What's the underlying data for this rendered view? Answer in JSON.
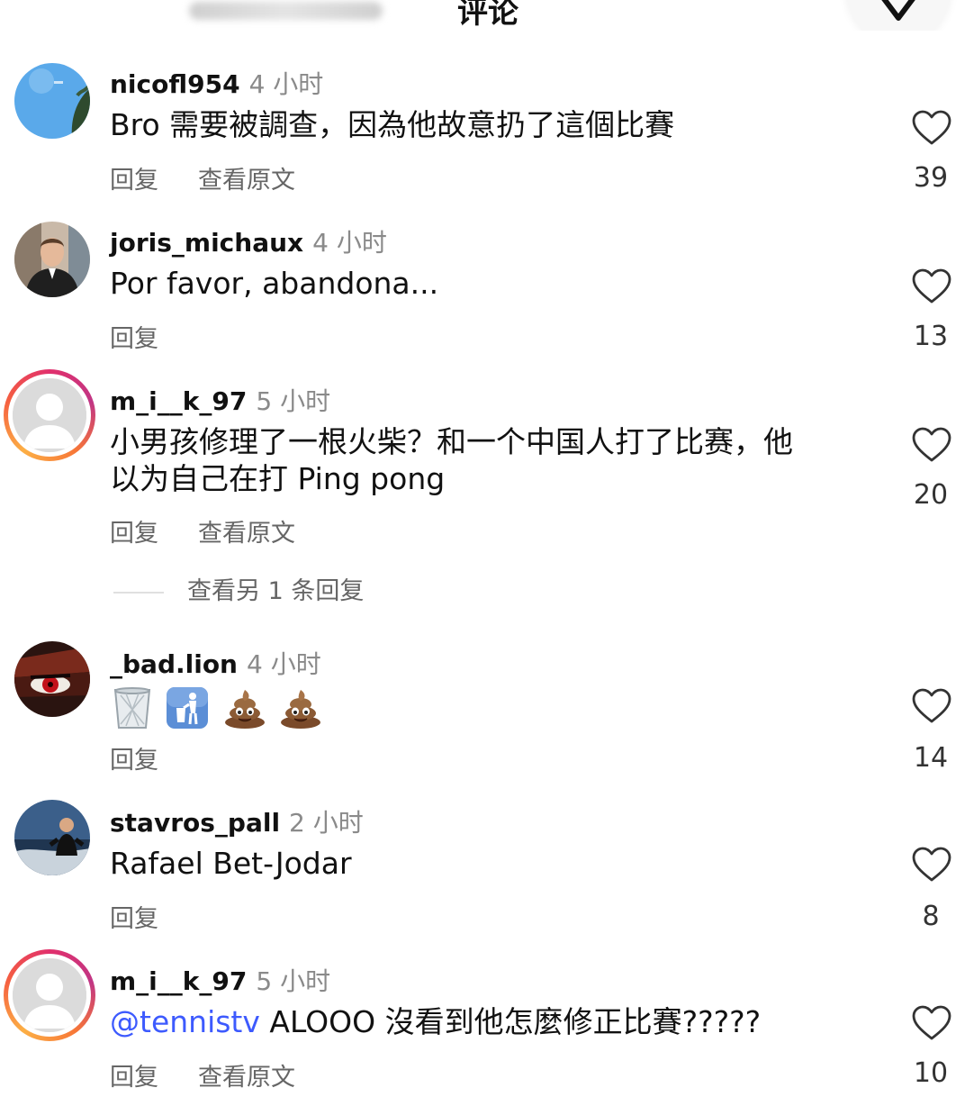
{
  "header": {
    "title": "评论"
  },
  "reply_label": "回复",
  "translate_label": "查看原文",
  "comments": [
    {
      "username": "nicofl954",
      "time": "4 小时",
      "text": "Bro 需要被調查，因為他故意扔了這個比賽",
      "likes": "39"
    },
    {
      "username": "joris_michaux",
      "time": "4 小时",
      "text": "Por favor, abandona...",
      "likes": "13"
    },
    {
      "username": "m_i__k_97",
      "time": "5 小时",
      "text_line1": "小男孩修理了一根火柴？和一个中国人打了比赛，他",
      "text_line2": "以为自己在打 Ping pong",
      "likes": "20",
      "more_replies": "查看另 1 条回复"
    },
    {
      "username": "_bad.lion",
      "time": "4 小时",
      "emojis": [
        "wastebasket",
        "litter-in-bin-sign",
        "pile-of-poo",
        "pile-of-poo"
      ],
      "likes": "14"
    },
    {
      "username": "stavros_pall",
      "time": "2 小时",
      "text": "Rafael Bet-Jodar",
      "likes": "8"
    },
    {
      "username": "m_i__k_97",
      "time": "5 小时",
      "mention": "@tennistv",
      "text": " ALOOO 沒看到他怎麼修正比賽?????",
      "likes": "10"
    }
  ],
  "colors": {
    "mention": "#3d5afe",
    "story_ring": [
      "#e1306c",
      "#fcaf45"
    ]
  }
}
